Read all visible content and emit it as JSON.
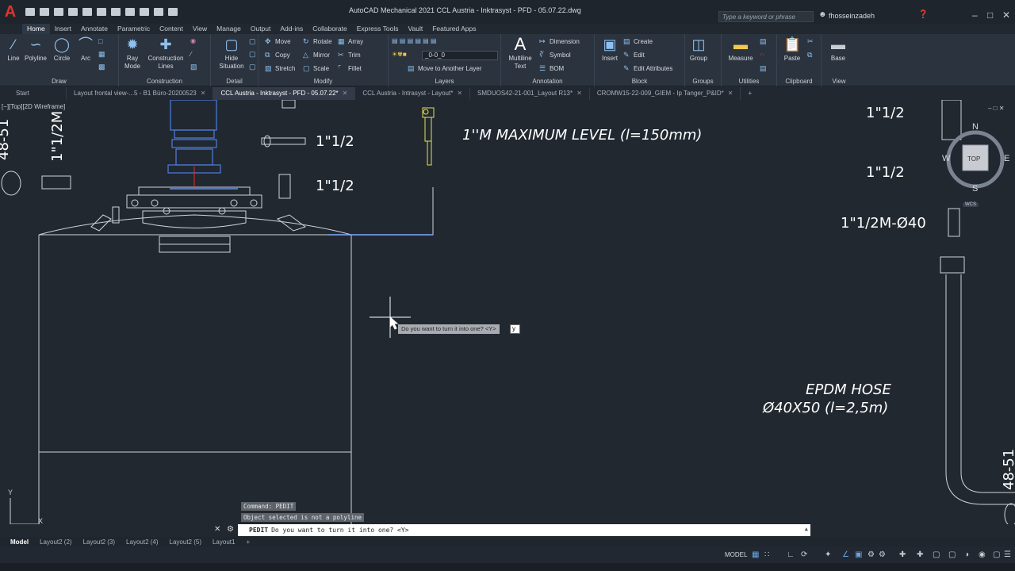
{
  "app": {
    "logo": "A",
    "title": "AutoCAD Mechanical 2021    CCL Austria - Inktrasyst - PFD - 05.07.22.dwg",
    "search_placeholder": "Type a keyword or phrase",
    "user": "fhosseinzadeh"
  },
  "ribbon_tabs": [
    "Home",
    "Insert",
    "Annotate",
    "Parametric",
    "Content",
    "View",
    "Manage",
    "Output",
    "Add-ins",
    "Collaborate",
    "Express Tools",
    "Vault",
    "Featured Apps"
  ],
  "ribbon": {
    "draw": {
      "title": "Draw",
      "line": "Line",
      "polyline": "Polyline",
      "circle": "Circle",
      "arc": "Arc"
    },
    "construction": {
      "title": "Construction",
      "ray1": "Ray",
      "ray2": "Mode",
      "cl1": "Construction",
      "cl2": "Lines"
    },
    "detail": {
      "title": "Detail",
      "hide1": "Hide",
      "hide2": "Situation"
    },
    "modify": {
      "title": "Modify",
      "move": "Move",
      "rotate": "Rotate",
      "array": "Array",
      "copy": "Copy",
      "mirror": "Mirror",
      "trim": "Trim",
      "stretch": "Stretch",
      "scale": "Scale",
      "fillet": "Fillet"
    },
    "layers": {
      "title": "Layers",
      "current": "_0-0_0",
      "move_layer": "Move to Another Layer"
    },
    "annotation": {
      "title": "Annotation",
      "mtext1": "Multiline",
      "mtext2": "Text",
      "dimension": "Dimension",
      "symbol": "Symbol",
      "bom": "BOM"
    },
    "block": {
      "title": "Block",
      "insert": "Insert",
      "create": "Create",
      "edit": "Edit",
      "edit_attr": "Edit Attributes"
    },
    "groups": {
      "title": "Groups",
      "group": "Group"
    },
    "utilities": {
      "title": "Utilities",
      "measure": "Measure"
    },
    "clipboard": {
      "title": "Clipboard",
      "paste": "Paste"
    },
    "view": {
      "title": "View",
      "base": "Base"
    }
  },
  "doc_tabs": [
    {
      "label": "Start"
    },
    {
      "label": "Layout frontal view-...5 - B1 Büro-20200523"
    },
    {
      "label": "CCL Austria - Inktrasyst - PFD - 05.07.22*"
    },
    {
      "label": "CCL Austria - Intrasyst - Layout*"
    },
    {
      "label": "SMDUOS42-21-001_Layout R13*"
    },
    {
      "label": "CROMW15-22-009_GIEM - Ip Tanger_P&ID*"
    }
  ],
  "viewport_label": "[−][Top][2D Wireframe]",
  "drawing_text": {
    "t1": "1\"1/2",
    "t2": "1\"1/2",
    "t3": "1''M MAXIMUM LEVEL (l=150mm)",
    "t4": "1\"1/2",
    "t5": "1\"1/2",
    "t6": "1\"1/2M-Ø40",
    "t7": "EPDM HOSE",
    "t8": "Ø40X50 (l=2,5m)",
    "t9": "48-51",
    "t10": "1\"1/2M",
    "t11": "48-51"
  },
  "viewcube": {
    "n": "N",
    "s": "S",
    "e": "E",
    "w": "W",
    "face": "TOP",
    "wcs": "WCS"
  },
  "cursor_prompt": {
    "text": "Do you want to turn it into one? <Y>",
    "value": "y"
  },
  "command": {
    "history1": "Command: PEDIT",
    "history2": "Object selected is not a polyline",
    "name": "PEDIT",
    "prompt": "Do you want to turn it into one? <Y>"
  },
  "layout_tabs": [
    "Model",
    "Layout2 (2)",
    "Layout2 (3)",
    "Layout2 (4)",
    "Layout2 (5)",
    "Layout1",
    "+"
  ],
  "status": {
    "model": "MODEL"
  }
}
